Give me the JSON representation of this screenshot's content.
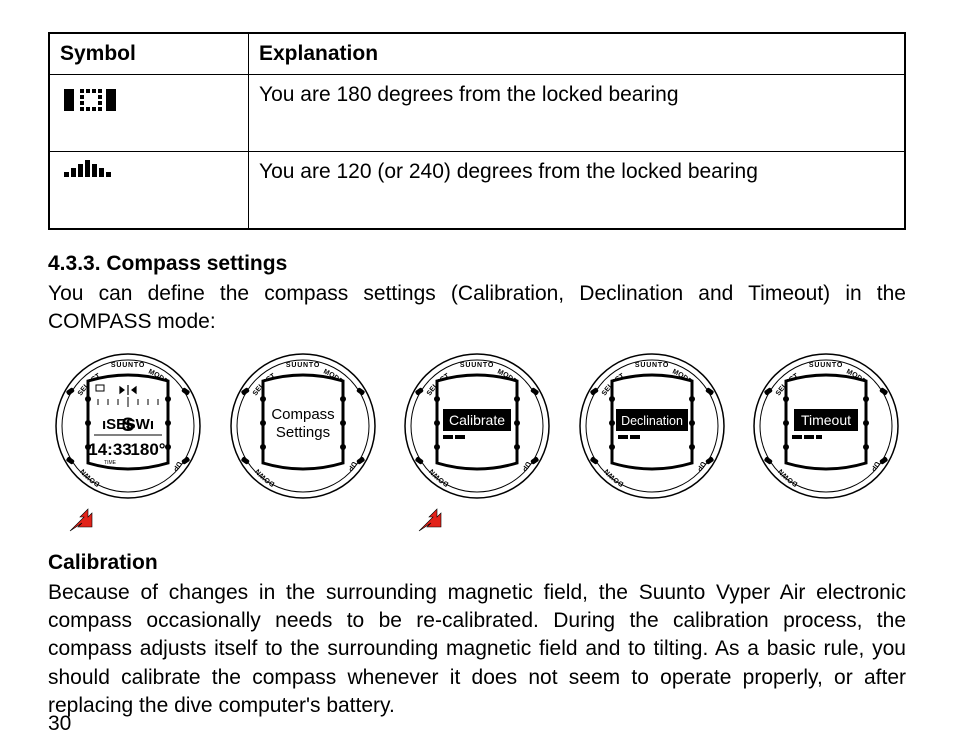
{
  "table": {
    "header": {
      "symbol": "Symbol",
      "explanation": "Explanation"
    },
    "rows": [
      {
        "explanation": "You are 180 degrees from the locked bearing"
      },
      {
        "explanation": "You are 120 (or 240) degrees from the locked bearing"
      }
    ]
  },
  "section": {
    "number": "4.3.3.",
    "title": "Compass settings",
    "intro": "You can define the compass settings (Calibration, Declination and Timeout) in the COMPASS mode:"
  },
  "watches": {
    "brand": "SUUNTO",
    "buttons": {
      "tl": "SELECT",
      "tr": "MODE",
      "bl": "DOWN",
      "br": "UP"
    },
    "compass": {
      "dir_left": "SE",
      "dir_arrow": "S",
      "dir_right": "SW",
      "time": "14:33",
      "bearing": "180",
      "time_label": "TIME"
    },
    "screens": [
      {
        "line1": "Compass",
        "line2": "Settings",
        "inverted": false
      },
      {
        "line1": "Calibrate",
        "inverted": true
      },
      {
        "line1": "Declination",
        "inverted": true
      },
      {
        "line1": "Timeout",
        "inverted": true
      }
    ]
  },
  "calibration": {
    "heading": "Calibration",
    "body": "Because of changes in the surrounding magnetic field, the Suunto Vyper Air electronic compass occasionally needs to be re-calibrated. During the calibration process, the compass adjusts itself to the surrounding magnetic field and to tilting. As a basic rule, you should calibrate the compass whenever it does not seem to operate properly, or after replacing the dive computer's battery."
  },
  "page_number": "30"
}
